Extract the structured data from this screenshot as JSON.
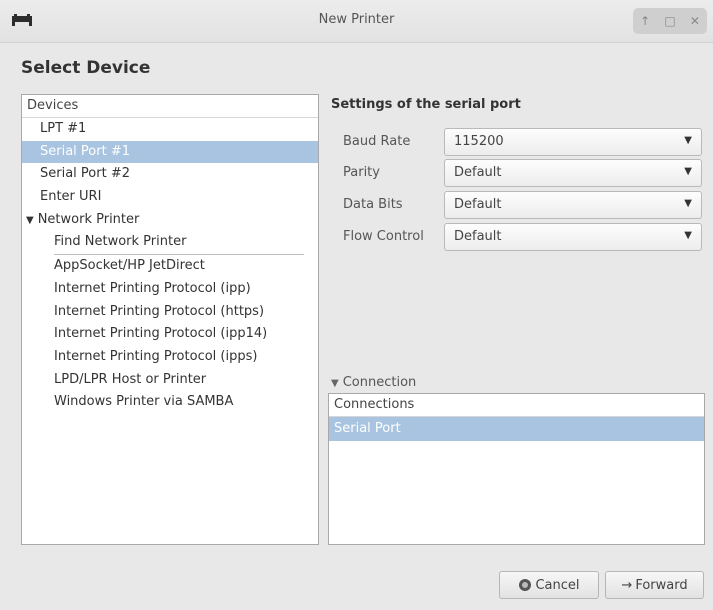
{
  "window": {
    "title": "New Printer",
    "controls": [
      "↑",
      "□",
      "✕"
    ]
  },
  "heading": "Select Device",
  "devices": {
    "header": "Devices",
    "items": [
      {
        "label": "LPT #1"
      },
      {
        "label": "Serial Port #1",
        "selected": true
      },
      {
        "label": "Serial Port #2"
      },
      {
        "label": "Enter URI"
      },
      {
        "label": "Network Printer",
        "expanded": true
      },
      {
        "label": "Find Network Printer"
      },
      {
        "label": "AppSocket/HP JetDirect"
      },
      {
        "label": "Internet Printing Protocol (ipp)"
      },
      {
        "label": "Internet Printing Protocol (https)"
      },
      {
        "label": "Internet Printing Protocol (ipp14)"
      },
      {
        "label": "Internet Printing Protocol (ipps)"
      },
      {
        "label": "LPD/LPR Host or Printer"
      },
      {
        "label": "Windows Printer via SAMBA"
      }
    ]
  },
  "settings": {
    "title": "Settings of the serial port",
    "rows": [
      {
        "label": "Baud Rate",
        "value": "115200"
      },
      {
        "label": "Parity",
        "value": "Default"
      },
      {
        "label": "Data Bits",
        "value": "Default"
      },
      {
        "label": "Flow Control",
        "value": "Default"
      }
    ]
  },
  "connection": {
    "expander_label": "Connection",
    "header": "Connections",
    "rows": [
      {
        "label": "Serial Port",
        "selected": true
      }
    ]
  },
  "buttons": {
    "cancel": "Cancel",
    "forward": "Forward"
  },
  "colors": {
    "selection": "#a8c4e0",
    "background": "#e8e8e8"
  }
}
